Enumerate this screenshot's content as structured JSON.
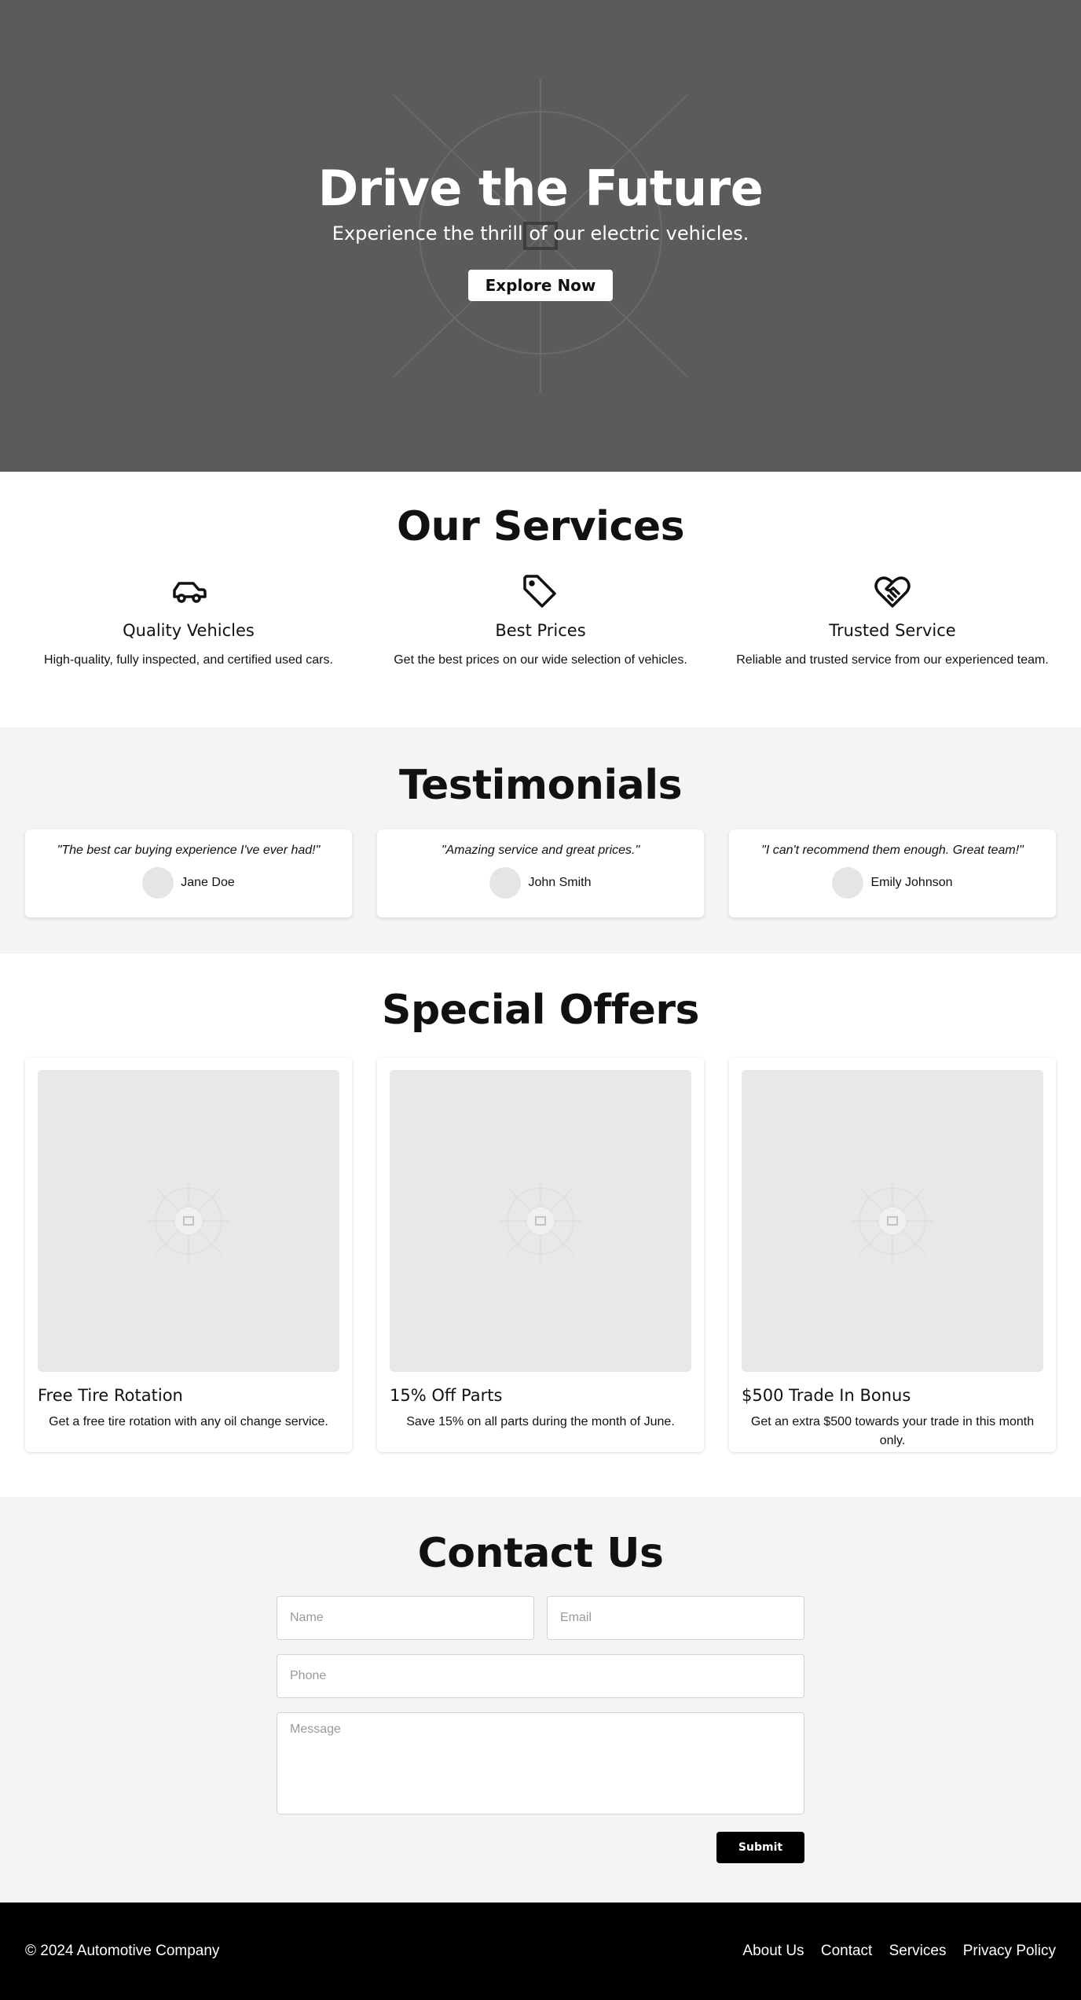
{
  "hero": {
    "title": "Drive the Future",
    "subtitle": "Experience the thrill of our electric vehicles.",
    "cta": "Explore Now"
  },
  "services": {
    "title": "Our Services",
    "items": [
      {
        "icon": "car-icon",
        "title": "Quality Vehicles",
        "text": "High-quality, fully inspected, and certified used cars."
      },
      {
        "icon": "tag-icon",
        "title": "Best Prices",
        "text": "Get the best prices on our wide selection of vehicles."
      },
      {
        "icon": "heart-handshake-icon",
        "title": "Trusted Service",
        "text": "Reliable and trusted service from our experienced team."
      }
    ]
  },
  "testimonials": {
    "title": "Testimonials",
    "items": [
      {
        "quote": "\"The best car buying experience I've ever had!\"",
        "name": "Jane Doe"
      },
      {
        "quote": "\"Amazing service and great prices.\"",
        "name": "John Smith"
      },
      {
        "quote": "\"I can't recommend them enough. Great team!\"",
        "name": "Emily Johnson"
      }
    ]
  },
  "offers": {
    "title": "Special Offers",
    "items": [
      {
        "title": "Free Tire Rotation",
        "text": "Get a free tire rotation with any oil change service."
      },
      {
        "title": "15% Off Parts",
        "text": "Save 15% on all parts during the month of June."
      },
      {
        "title": "$500 Trade In Bonus",
        "text": "Get an extra $500 towards your trade in this month only."
      }
    ]
  },
  "contact": {
    "title": "Contact Us",
    "name_placeholder": "Name",
    "email_placeholder": "Email",
    "phone_placeholder": "Phone",
    "message_placeholder": "Message",
    "submit": "Submit"
  },
  "footer": {
    "copyright": "© 2024 Automotive Company",
    "links": [
      "About Us",
      "Contact",
      "Services",
      "Privacy Policy"
    ]
  }
}
